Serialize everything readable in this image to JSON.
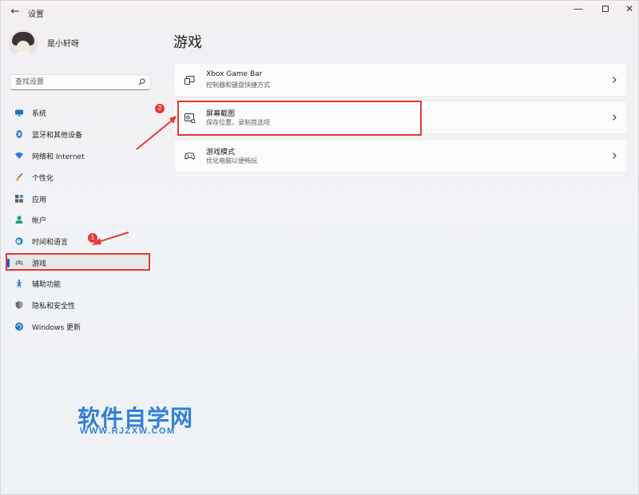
{
  "titlebar": {
    "back_glyph": "←",
    "title": "设置",
    "minimize_glyph": "—",
    "close_glyph": "✕"
  },
  "user": {
    "name": "是小轩呀"
  },
  "search": {
    "placeholder": "查找设置"
  },
  "sidebar": {
    "items": [
      {
        "label": "系统",
        "icon": "system-icon"
      },
      {
        "label": "蓝牙和其他设备",
        "icon": "bluetooth-icon"
      },
      {
        "label": "网络和 Internet",
        "icon": "wifi-icon"
      },
      {
        "label": "个性化",
        "icon": "brush-icon"
      },
      {
        "label": "应用",
        "icon": "apps-icon"
      },
      {
        "label": "帐户",
        "icon": "account-icon"
      },
      {
        "label": "时间和语言",
        "icon": "globe-clock-icon"
      },
      {
        "label": "游戏",
        "icon": "gamepad-icon",
        "selected": true
      },
      {
        "label": "辅助功能",
        "icon": "accessibility-icon"
      },
      {
        "label": "隐私和安全性",
        "icon": "shield-icon"
      },
      {
        "label": "Windows 更新",
        "icon": "update-icon"
      }
    ]
  },
  "main": {
    "title": "游戏",
    "cards": [
      {
        "title": "Xbox Game Bar",
        "subtitle": "控制器和键盘快捷方式",
        "icon": "game-bar-icon"
      },
      {
        "title": "屏幕截图",
        "subtitle": "保存位置，录制首选项",
        "icon": "capture-icon"
      },
      {
        "title": "游戏模式",
        "subtitle": "优化电脑以便畅玩",
        "icon": "game-mode-icon"
      }
    ]
  },
  "annotations": {
    "badge_1": "1",
    "badge_2": "2",
    "color": "#e53935"
  },
  "watermark": {
    "title": "软件自学网",
    "url": "WWW.RJZXW.COM",
    "color": "#2f7fd8"
  },
  "colors": {
    "accent": "#0067c0"
  }
}
